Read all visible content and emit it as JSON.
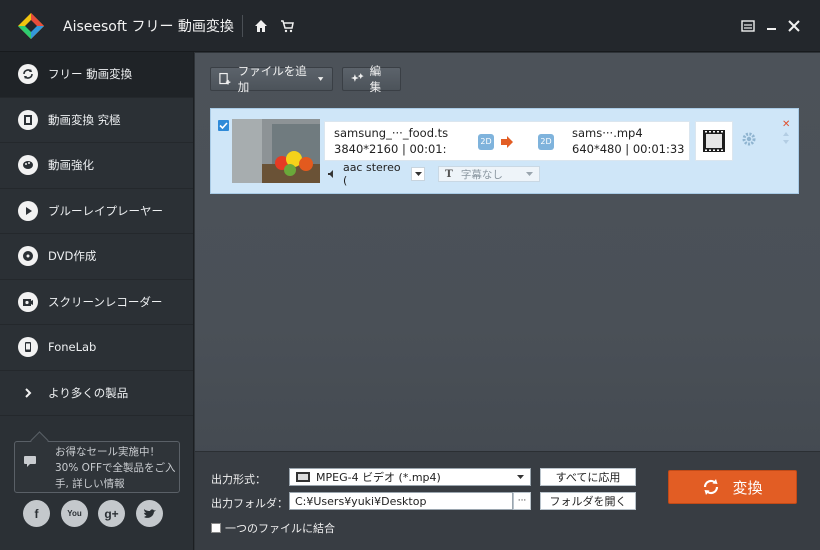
{
  "app": {
    "title": "Aiseesoft フリー 動画変換"
  },
  "sidebar": {
    "items": [
      {
        "label": "フリー 動画変換"
      },
      {
        "label": "動画変換 究極"
      },
      {
        "label": "動画強化"
      },
      {
        "label": "ブルーレイプレーヤー"
      },
      {
        "label": "DVD作成"
      },
      {
        "label": "スクリーンレコーダー"
      },
      {
        "label": "FoneLab"
      },
      {
        "label": "より多くの製品"
      }
    ],
    "promo_text": "お得なセール実施中！30% OFFで全製品をご入手, 詳しい情報",
    "social": [
      "facebook",
      "youtube",
      "google-plus",
      "twitter"
    ]
  },
  "toolbar": {
    "add_file_label": "ファイルを追加",
    "edit_label": "編集"
  },
  "file": {
    "source_name": "samsung_···_food.ts",
    "source_meta": "3840*2160 | 00:01:",
    "badge_source": "2D",
    "badge_target": "2D",
    "target_name": "sams···.mp4",
    "target_meta": "640*480 | 00:01:33",
    "audio": "aac stereo (",
    "subtitle": "字幕なし"
  },
  "output": {
    "format_label": "出力形式：",
    "format_value": "MPEG-4 ビデオ (*.mp4)",
    "apply_all_label": "すべてに応用",
    "folder_label": "出力フォルダ：",
    "folder_value": "C:¥Users¥yuki¥Desktop",
    "browse_label": "···",
    "open_folder_label": "フォルダを開く",
    "merge_label": "一つのファイルに結合",
    "convert_label": "変換"
  },
  "colors": {
    "accent": "#e25d24",
    "selection": "#cfe6f8"
  }
}
